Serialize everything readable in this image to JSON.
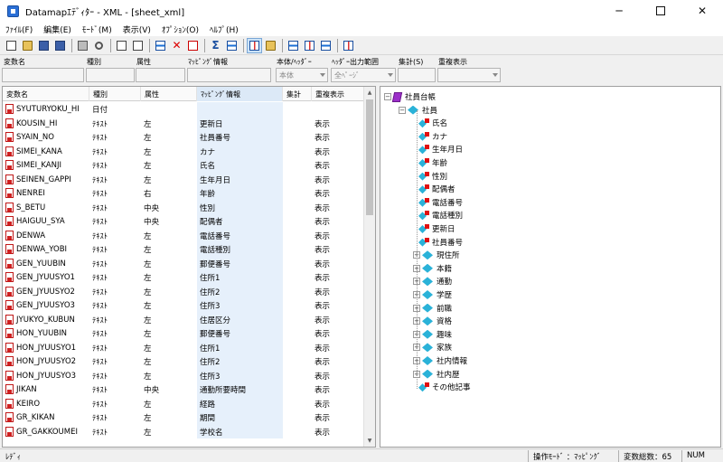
{
  "window": {
    "title": "Datamapｴﾃﾞｨﾀｰ - XML - [sheet_xml]"
  },
  "menu": [
    "ﾌｧｲﾙ(F)",
    "編集(E)",
    "ﾓｰﾄﾞ(M)",
    "表示(V)",
    "ｵﾌﾟｼｮﾝ(O)",
    "ﾍﾙﾌﾟ(H)"
  ],
  "toolbar": {
    "icons": [
      "new-icon",
      "open-icon",
      "save-icon",
      "save-all-icon",
      "print-icon",
      "print-preview-icon",
      "copy-icon",
      "paste-icon",
      "move-icon",
      "delete-icon",
      "cut-icon",
      "sum-icon",
      "grid-icon",
      "mapping-icon",
      "tree-icon",
      "map-add-icon",
      "map-remove-icon",
      "map-edit-icon",
      "layout-icon"
    ]
  },
  "fields": {
    "labels": [
      "変数名",
      "種別",
      "属性",
      "ﾏｯﾋﾟﾝｸﾞ情報",
      "本体/ﾍｯﾀﾞｰ",
      "ﾍｯﾀﾞｰ出力範囲",
      "集計(S)",
      "重複表示"
    ],
    "body_value": "本体",
    "range_value": "全ﾍﾟｰｼﾞ"
  },
  "grid": {
    "columns": [
      "変数名",
      "種別",
      "属性",
      "ﾏｯﾋﾟﾝｸﾞ情報",
      "集計",
      "重複表示"
    ],
    "rows": [
      [
        "SYUTURYOKU_HI",
        "日付",
        "",
        "",
        "",
        ""
      ],
      [
        "KOUSIN_HI",
        "ﾃｷｽﾄ",
        "左",
        "更新日",
        "",
        "表示"
      ],
      [
        "SYAIN_NO",
        "ﾃｷｽﾄ",
        "左",
        "社員番号",
        "",
        "表示"
      ],
      [
        "SIMEI_KANA",
        "ﾃｷｽﾄ",
        "左",
        "カナ",
        "",
        "表示"
      ],
      [
        "SIMEI_KANJI",
        "ﾃｷｽﾄ",
        "左",
        "氏名",
        "",
        "表示"
      ],
      [
        "SEINEN_GAPPI",
        "ﾃｷｽﾄ",
        "左",
        "生年月日",
        "",
        "表示"
      ],
      [
        "NENREI",
        "ﾃｷｽﾄ",
        "右",
        "年齢",
        "",
        "表示"
      ],
      [
        "S_BETU",
        "ﾃｷｽﾄ",
        "中央",
        "性別",
        "",
        "表示"
      ],
      [
        "HAIGUU_SYA",
        "ﾃｷｽﾄ",
        "中央",
        "配偶者",
        "",
        "表示"
      ],
      [
        "DENWA",
        "ﾃｷｽﾄ",
        "左",
        "電話番号",
        "",
        "表示"
      ],
      [
        "DENWA_YOBI",
        "ﾃｷｽﾄ",
        "左",
        "電話種別",
        "",
        "表示"
      ],
      [
        "GEN_YUUBIN",
        "ﾃｷｽﾄ",
        "左",
        "郵便番号",
        "",
        "表示"
      ],
      [
        "GEN_JYUUSYO1",
        "ﾃｷｽﾄ",
        "左",
        "住所1",
        "",
        "表示"
      ],
      [
        "GEN_JYUUSYO2",
        "ﾃｷｽﾄ",
        "左",
        "住所2",
        "",
        "表示"
      ],
      [
        "GEN_JYUUSYO3",
        "ﾃｷｽﾄ",
        "左",
        "住所3",
        "",
        "表示"
      ],
      [
        "JYUKYO_KUBUN",
        "ﾃｷｽﾄ",
        "左",
        "住居区分",
        "",
        "表示"
      ],
      [
        "HON_YUUBIN",
        "ﾃｷｽﾄ",
        "左",
        "郵便番号",
        "",
        "表示"
      ],
      [
        "HON_JYUUSYO1",
        "ﾃｷｽﾄ",
        "左",
        "住所1",
        "",
        "表示"
      ],
      [
        "HON_JYUUSYO2",
        "ﾃｷｽﾄ",
        "左",
        "住所2",
        "",
        "表示"
      ],
      [
        "HON_JYUUSYO3",
        "ﾃｷｽﾄ",
        "左",
        "住所3",
        "",
        "表示"
      ],
      [
        "JIKAN",
        "ﾃｷｽﾄ",
        "中央",
        "通勤所要時間",
        "",
        "表示"
      ],
      [
        "KEIRO",
        "ﾃｷｽﾄ",
        "左",
        "経路",
        "",
        "表示"
      ],
      [
        "GR_KIKAN",
        "ﾃｷｽﾄ",
        "左",
        "期間",
        "",
        "表示"
      ],
      [
        "GR_GAKKOUMEI",
        "ﾃｷｽﾄ",
        "左",
        "学校名",
        "",
        "表示"
      ]
    ]
  },
  "tree": {
    "root": "社員台帳",
    "group": "社員",
    "leaves": [
      "氏名",
      "カナ",
      "生年月日",
      "年齢",
      "性別",
      "配偶者",
      "電話番号",
      "電話種別",
      "更新日",
      "社員番号"
    ],
    "subgroups": [
      "現住所",
      "本籍",
      "通勤",
      "学歴",
      "前職",
      "資格",
      "趣味",
      "家族",
      "社内情報",
      "社内歴"
    ],
    "last_leaf": "その他記事"
  },
  "status": {
    "ready": "ﾚﾃﾞｨ",
    "mode": "操作ﾓｰﾄﾞ ：ﾏｯﾋﾟﾝｸﾞ",
    "count": "変数総数：65",
    "num": "NUM"
  }
}
